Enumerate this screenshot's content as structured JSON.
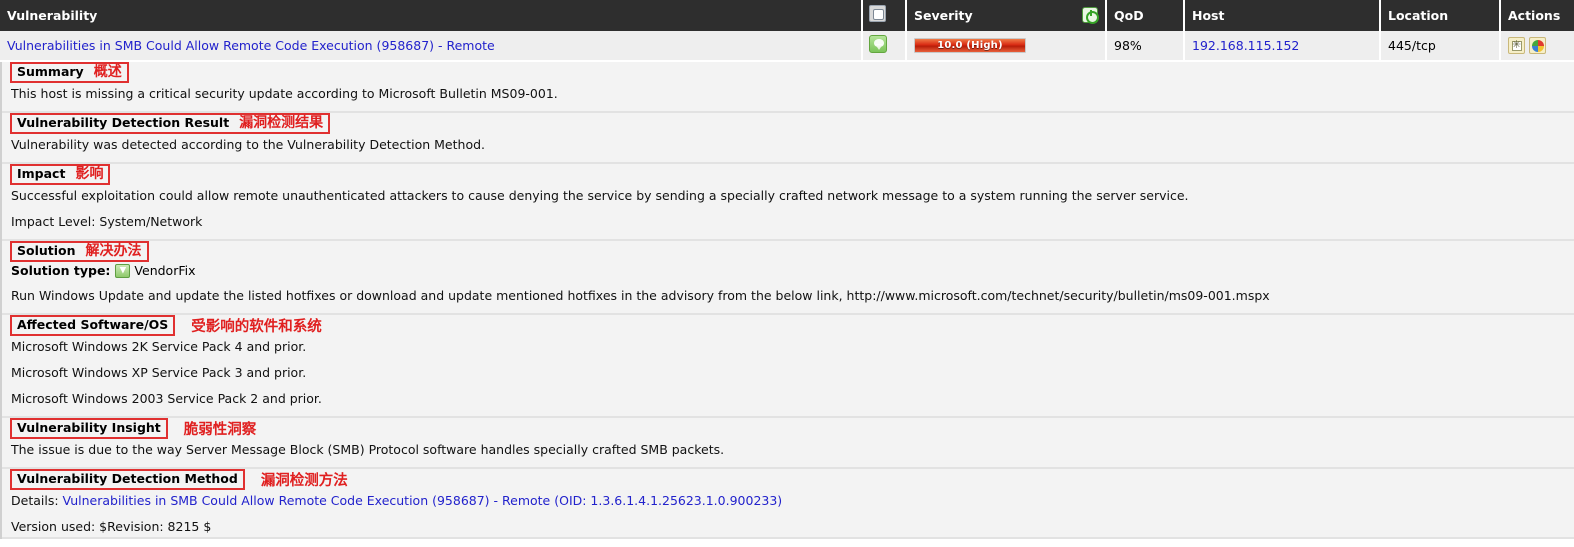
{
  "table": {
    "columns": [
      {
        "key": "vulnerability",
        "label": "Vulnerability"
      },
      {
        "key": "solution_type",
        "label": "",
        "icon": "puzzle-icon"
      },
      {
        "key": "severity",
        "label": "Severity",
        "icon": "power-sort-icon"
      },
      {
        "key": "qod",
        "label": "QoD"
      },
      {
        "key": "host",
        "label": "Host"
      },
      {
        "key": "location",
        "label": "Location"
      },
      {
        "key": "actions",
        "label": "Actions"
      }
    ],
    "row": {
      "vulnerability": "Vulnerabilities in SMB Could Allow Remote Code Execution (958687) - Remote",
      "solution_type_icon": "vendorfix-shield-icon",
      "severity": "10.0 (High)",
      "severity_color": "#d92a13",
      "qod": "98%",
      "host": "192.168.115.152",
      "location": "445/tcp",
      "actions": [
        "tag-icon",
        "color-wheel-icon"
      ]
    }
  },
  "sections": {
    "summary": {
      "title": "Summary",
      "title_cn": "概述",
      "cn_inside_box": true,
      "lines": [
        "This host is missing a critical security update according to Microsoft Bulletin MS09-001."
      ]
    },
    "detection_result": {
      "title": "Vulnerability Detection Result",
      "title_cn": "漏洞检测结果",
      "cn_inside_box": true,
      "lines": [
        "Vulnerability was detected according to the Vulnerability Detection Method."
      ]
    },
    "impact": {
      "title": "Impact",
      "title_cn": "影响",
      "cn_inside_box": true,
      "lines": [
        "Successful exploitation could allow remote unauthenticated attackers to cause denying the service by sending a specially crafted network message to a system running the server service.",
        "Impact Level: System/Network"
      ]
    },
    "solution": {
      "title": "Solution",
      "title_cn": "解决办法",
      "cn_inside_box": true,
      "solution_type_label": "Solution type:",
      "solution_type_value": "VendorFix",
      "lines": [
        "Run Windows Update and update the listed hotfixes or download and update mentioned hotfixes in the advisory from the below link, http://www.microsoft.com/technet/security/bulletin/ms09-001.mspx"
      ]
    },
    "affected": {
      "title": "Affected Software/OS",
      "title_cn": "受影响的软件和系统",
      "cn_inside_box": false,
      "lines": [
        "Microsoft Windows 2K Service Pack 4 and prior.",
        "Microsoft Windows XP Service Pack 3 and prior.",
        "Microsoft Windows 2003 Service Pack 2 and prior."
      ]
    },
    "insight": {
      "title": "Vulnerability Insight",
      "title_cn": "脆弱性洞察",
      "cn_inside_box": false,
      "lines": [
        "The issue is due to the way Server Message Block (SMB) Protocol software handles specially crafted SMB packets."
      ]
    },
    "detection_method": {
      "title": "Vulnerability Detection Method",
      "title_cn": "漏洞检测方法",
      "cn_inside_box": false,
      "details_prefix": "Details:",
      "details_link": "Vulnerabilities in SMB Could Allow Remote Code Execution (958687) - Remote (OID: 1.3.6.1.4.1.25623.1.0.900233)",
      "version_line": "Version used: $Revision: 8215 $"
    }
  }
}
